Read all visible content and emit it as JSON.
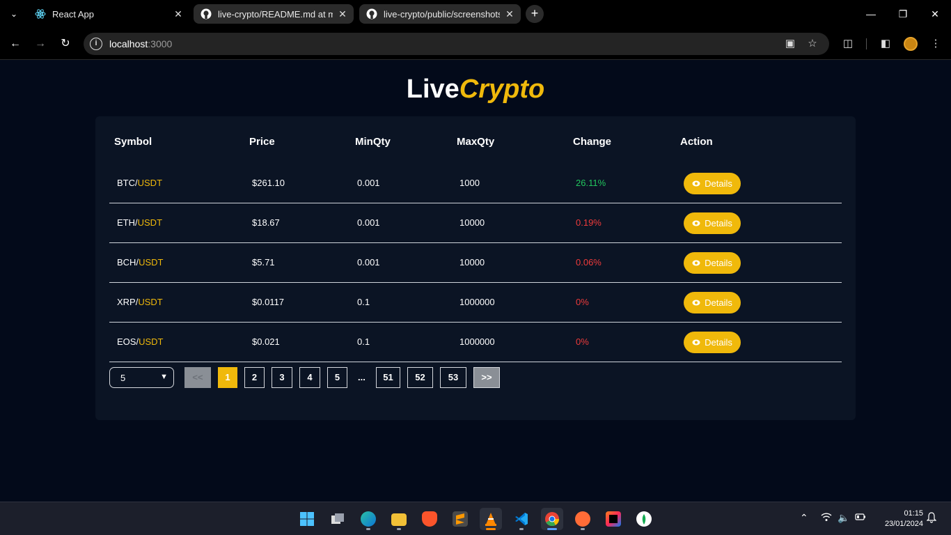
{
  "browser": {
    "tabs": [
      {
        "title": "React App",
        "active": true
      },
      {
        "title": "live-crypto/README.md at mas",
        "active": false
      },
      {
        "title": "live-crypto/public/screenshots",
        "active": false
      }
    ],
    "url_host": "localhost",
    "url_port": ":3000"
  },
  "brand": {
    "part1": "Live",
    "part2": "Crypto"
  },
  "table": {
    "headers": [
      "Symbol",
      "Price",
      "MinQty",
      "MaxQty",
      "Change",
      "Action"
    ],
    "rows": [
      {
        "base": "BTC/",
        "quote": "USDT",
        "price": "$261.10",
        "minqty": "0.001",
        "maxqty": "1000",
        "change": "26.11%",
        "direction": "up",
        "action": "Details"
      },
      {
        "base": "ETH/",
        "quote": "USDT",
        "price": "$18.67",
        "minqty": "0.001",
        "maxqty": "10000",
        "change": "0.19%",
        "direction": "down",
        "action": "Details"
      },
      {
        "base": "BCH/",
        "quote": "USDT",
        "price": "$5.71",
        "minqty": "0.001",
        "maxqty": "10000",
        "change": "0.06%",
        "direction": "down",
        "action": "Details"
      },
      {
        "base": "XRP/",
        "quote": "USDT",
        "price": "$0.0117",
        "minqty": "0.1",
        "maxqty": "1000000",
        "change": "0%",
        "direction": "down",
        "action": "Details"
      },
      {
        "base": "EOS/",
        "quote": "USDT",
        "price": "$0.021",
        "minqty": "0.1",
        "maxqty": "1000000",
        "change": "0%",
        "direction": "down",
        "action": "Details"
      }
    ]
  },
  "pagination": {
    "page_size": "5",
    "prev": "<<",
    "next": ">>",
    "pages": [
      "1",
      "2",
      "3",
      "4",
      "5"
    ],
    "ellipsis": "...",
    "last_pages": [
      "51",
      "52",
      "53"
    ],
    "current": "1"
  },
  "colors": {
    "accent": "#f0b90b",
    "up": "#22c55e",
    "down": "#ef3b3b",
    "background": "#030a1a",
    "card": "#0b1424"
  },
  "taskbar": {
    "apps": [
      "windows-start-icon",
      "task-view-icon",
      "edge-icon",
      "file-explorer-icon",
      "brave-icon",
      "sublime-text-icon",
      "vlc-icon",
      "vscode-icon",
      "chrome-icon",
      "postman-icon",
      "intellij-icon",
      "mongodb-compass-icon"
    ],
    "time": "01:15",
    "date": "23/01/2024"
  }
}
